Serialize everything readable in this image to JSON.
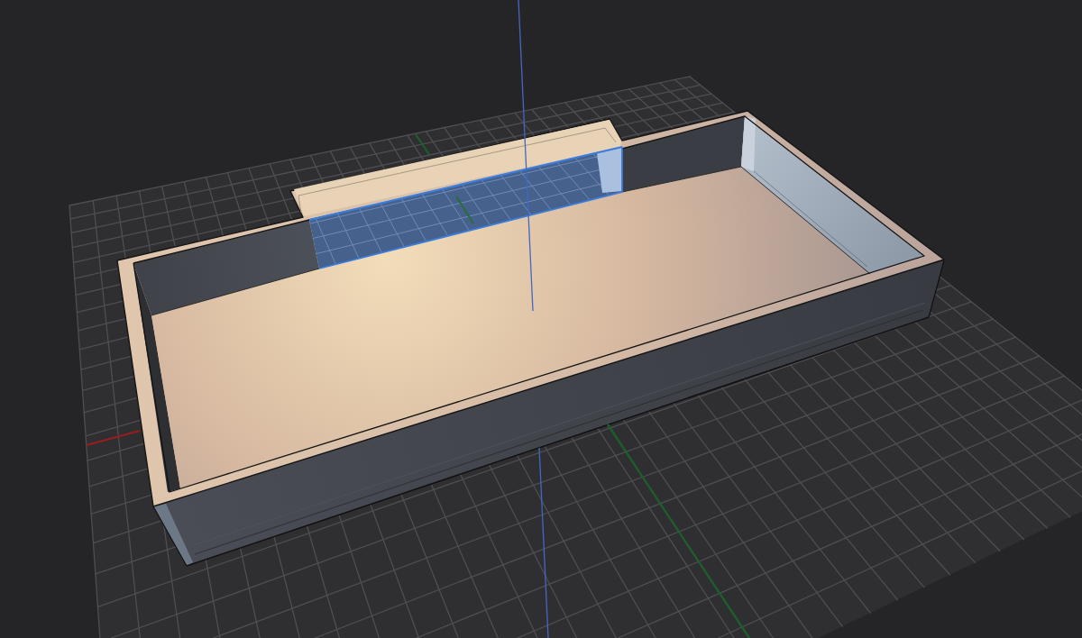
{
  "viewport": {
    "grid_visible": true,
    "axes_visible": true,
    "model": {
      "face_selected": true
    }
  }
}
